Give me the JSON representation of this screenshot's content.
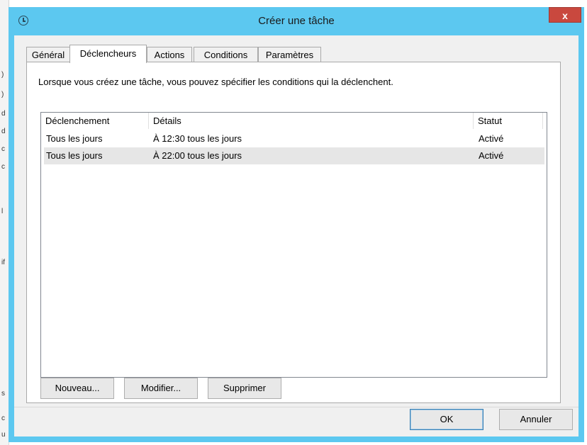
{
  "window": {
    "title": "Créer une tâche",
    "close_label": "x"
  },
  "background": {
    "glyphs": [
      ")",
      ")",
      "d",
      "d",
      "c",
      "c",
      "l",
      "if",
      "s",
      "c",
      "u"
    ]
  },
  "tabs": [
    {
      "label": "Général",
      "active": false
    },
    {
      "label": "Déclencheurs",
      "active": true
    },
    {
      "label": "Actions",
      "active": false
    },
    {
      "label": "Conditions",
      "active": false
    },
    {
      "label": "Paramètres",
      "active": false
    }
  ],
  "panel": {
    "description": "Lorsque vous créez une tâche, vous pouvez spécifier les conditions qui la déclenchent.",
    "columns": [
      "Déclenchement",
      "Détails",
      "Statut"
    ],
    "rows": [
      {
        "trigger": "Tous les jours",
        "details": "À 12:30 tous les jours",
        "status": "Activé",
        "selected": false
      },
      {
        "trigger": "Tous les jours",
        "details": "À 22:00 tous les jours",
        "status": "Activé",
        "selected": true
      }
    ],
    "buttons": {
      "new": "Nouveau...",
      "edit": "Modifier...",
      "delete": "Supprimer"
    }
  },
  "footer": {
    "ok": "OK",
    "cancel": "Annuler"
  },
  "colors": {
    "titlebar": "#5cc8f0",
    "close": "#c9483e",
    "selection": "#e6e6e6"
  }
}
